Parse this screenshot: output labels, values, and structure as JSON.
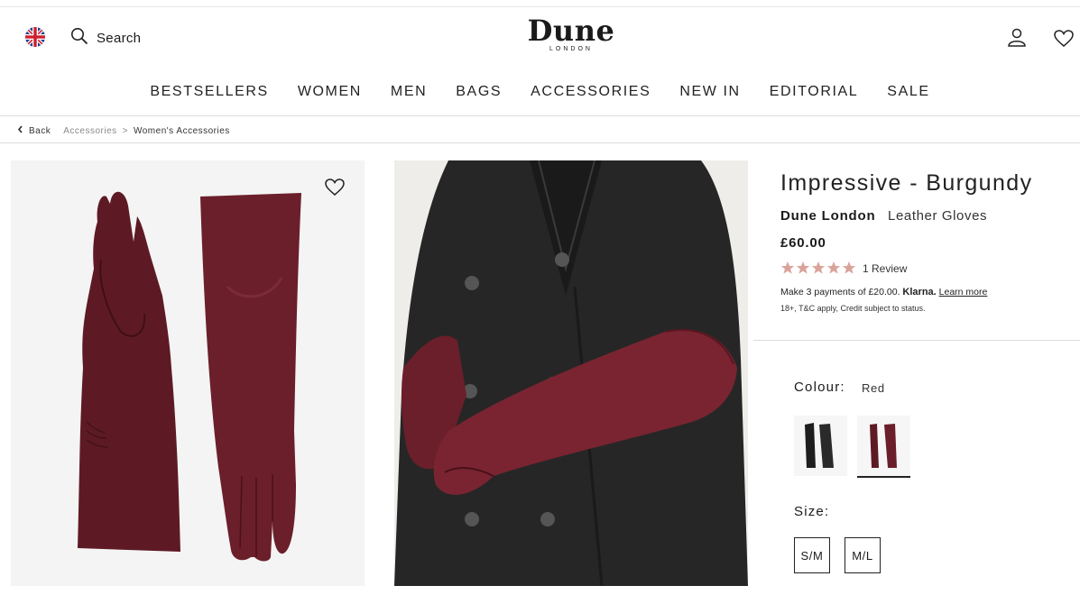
{
  "header": {
    "search_label": "Search",
    "logo_main": "Dune",
    "logo_sub": "LONDON"
  },
  "nav": [
    "BESTSELLERS",
    "WOMEN",
    "MEN",
    "BAGS",
    "ACCESSORIES",
    "NEW IN",
    "EDITORIAL",
    "SALE"
  ],
  "breadcrumb": {
    "back": "Back",
    "items": [
      "Accessories",
      ">",
      "Women's Accessories"
    ]
  },
  "product": {
    "title": "Impressive - Burgundy",
    "brand": "Dune London",
    "type": "Leather Gloves",
    "price": "£60.00",
    "rating": 5,
    "reviews": "1 Review",
    "payment_prefix": "Make 3 payments of £20.00.",
    "payment_provider": "Klarna.",
    "payment_link": "Learn more",
    "terms": "18+, T&C apply, Credit subject to status.",
    "colour_label": "Colour:",
    "colour_value": "Red",
    "size_label": "Size:",
    "sizes": [
      "S/M",
      "M/L"
    ]
  },
  "colors": {
    "burgundy": "#6b1f2a",
    "coat": "#2a2a2a",
    "star": "#d9a39b"
  }
}
